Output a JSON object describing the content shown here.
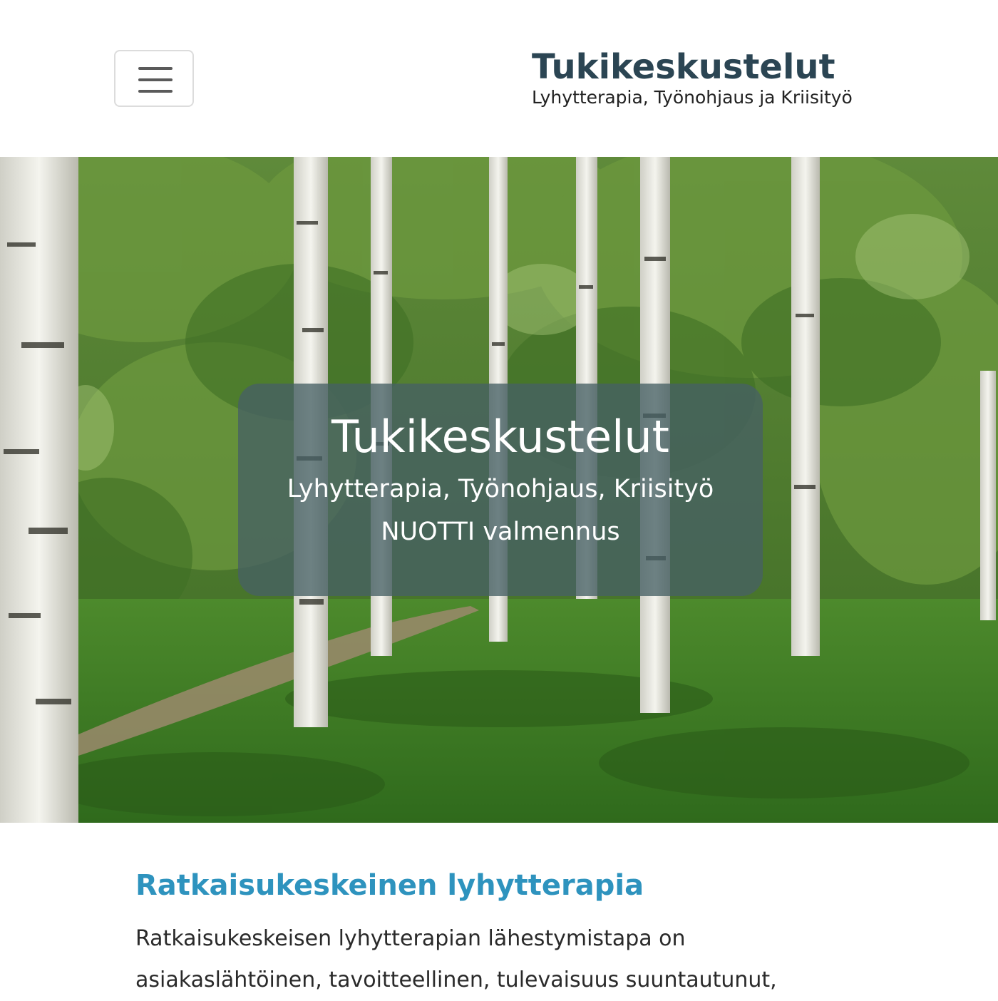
{
  "header": {
    "menu_icon": "hamburger-icon",
    "brand_title": "Tukikeskustelut",
    "brand_subtitle": "Lyhytterapia, Työnohjaus ja Kriisityö"
  },
  "hero": {
    "image_subject": "birch-forest-park",
    "title": "Tukikeskustelut",
    "line1": "Lyhytterapia, Työnohjaus, Kriisityö",
    "line2": "NUOTTI valmennus"
  },
  "content": {
    "heading": "Ratkaisukeskeinen lyhytterapia",
    "paragraph": "Ratkaisukeskeisen lyhytterapian lähestymistapa on asiakaslähtöinen, tavoitteellinen, tulevaisuus suuntautunut,"
  },
  "colors": {
    "brand": "#2b4553",
    "accent": "#2e93be",
    "overlay": "#466064"
  }
}
